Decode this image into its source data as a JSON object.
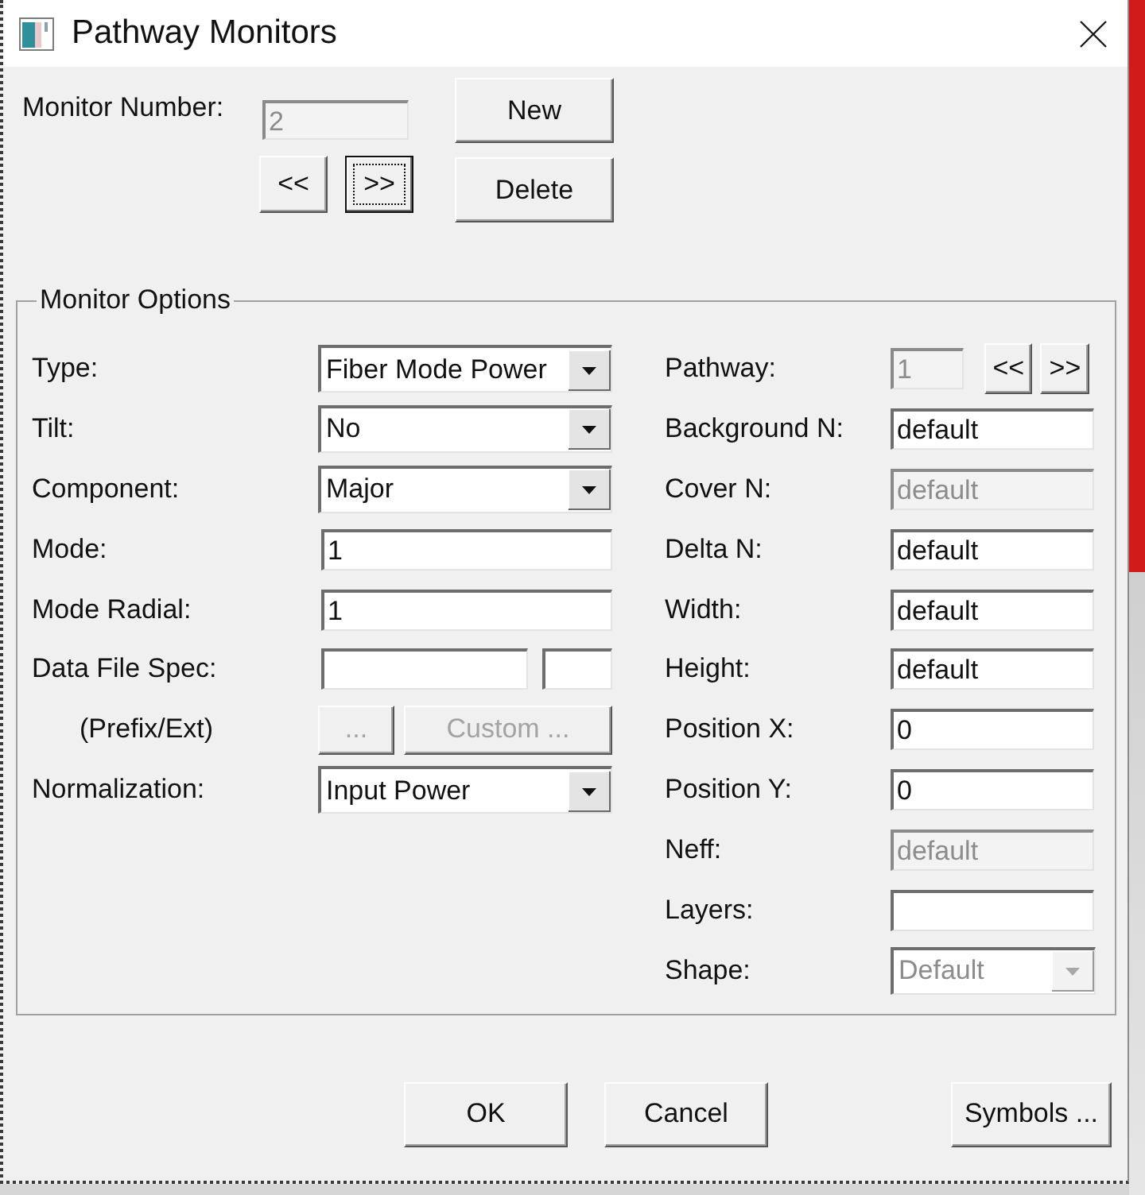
{
  "window": {
    "title": "Pathway Monitors"
  },
  "monitor": {
    "label": "Monitor Number:",
    "value": "2",
    "disabled": true,
    "nav_buttons": [
      {
        "label": "<<",
        "focused": false
      },
      {
        "label": ">>",
        "focused": true
      }
    ],
    "actions": [
      {
        "label": "New"
      },
      {
        "label": "Delete"
      }
    ]
  },
  "monitor_options": {
    "title": "Monitor Options",
    "left_fields": [
      {
        "kind": "dropdown",
        "label": "Type:",
        "value": "Fiber Mode Power",
        "disabled": false
      },
      {
        "kind": "dropdown",
        "label": "Tilt:",
        "value": "No",
        "disabled": false
      },
      {
        "kind": "dropdown",
        "label": "Component:",
        "value": "Major",
        "disabled": false
      },
      {
        "kind": "text",
        "label": "Mode:",
        "value": "1",
        "disabled": false
      },
      {
        "kind": "text",
        "label": "Mode Radial:",
        "value": "1",
        "disabled": false
      },
      {
        "kind": "pair",
        "label": "Data File Spec:",
        "disabled": false
      },
      {
        "kind": "buttons",
        "label": "(Prefix/Ext)",
        "buttons": [
          {
            "label": "...",
            "disabled": true
          },
          {
            "label": "Custom ...",
            "disabled": true
          }
        ]
      },
      {
        "kind": "dropdown",
        "label": "Normalization:",
        "value": "Input Power",
        "disabled": false
      }
    ],
    "right_fields": [
      {
        "kind": "stepper",
        "label": "Pathway:",
        "value": "1",
        "disabled": true,
        "buttons": [
          {
            "label": "<<",
            "disabled": false
          },
          {
            "label": ">>",
            "disabled": false
          }
        ]
      },
      {
        "kind": "text",
        "label": "Background N:",
        "value": "default",
        "disabled": false
      },
      {
        "kind": "text",
        "label": "Cover N:",
        "value": "default",
        "disabled": true
      },
      {
        "kind": "text",
        "label": "Delta N:",
        "value": "default",
        "disabled": false
      },
      {
        "kind": "text",
        "label": "Width:",
        "value": "default",
        "disabled": false
      },
      {
        "kind": "text",
        "label": "Height:",
        "value": "default",
        "disabled": false
      },
      {
        "kind": "text",
        "label": "Position X:",
        "value": "0",
        "disabled": false
      },
      {
        "kind": "text",
        "label": "Position Y:",
        "value": "0",
        "disabled": false
      },
      {
        "kind": "text",
        "label": "Neff:",
        "value": "default",
        "disabled": true
      },
      {
        "kind": "text",
        "label": "Layers:",
        "disabled": false
      },
      {
        "kind": "dropdown",
        "label": "Shape:",
        "value": "Default",
        "disabled": true
      }
    ]
  },
  "footer_buttons": [
    {
      "label": "OK"
    },
    {
      "label": "Cancel"
    },
    {
      "label": "Symbols ..."
    }
  ]
}
